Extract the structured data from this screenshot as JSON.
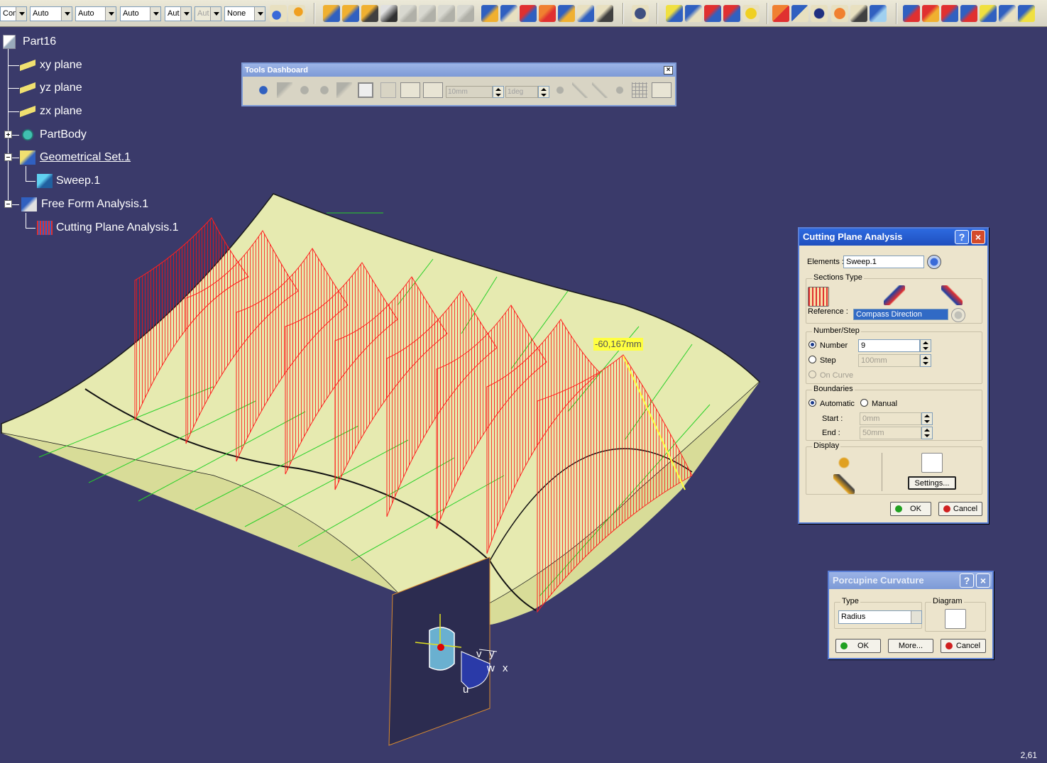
{
  "toolbar": {
    "combos": [
      {
        "value": "Come",
        "disabled": false
      },
      {
        "value": "Auto",
        "disabled": false
      },
      {
        "value": "Auto",
        "disabled": false
      },
      {
        "value": "Auto",
        "disabled": false
      },
      {
        "value": "Aut",
        "disabled": false
      },
      {
        "value": "Aut",
        "disabled": true
      },
      {
        "value": "None",
        "disabled": false
      }
    ]
  },
  "tree": {
    "root": "Part16",
    "nodes": [
      {
        "label": "xy plane",
        "icon": "plane-icon"
      },
      {
        "label": "yz plane",
        "icon": "plane-icon"
      },
      {
        "label": "zx plane",
        "icon": "plane-icon"
      },
      {
        "label": "PartBody",
        "icon": "gear-body-icon"
      },
      {
        "label": "Geometrical Set.1",
        "icon": "geometrical-set-icon"
      },
      {
        "label": "Sweep.1",
        "icon": "sweep-icon"
      },
      {
        "label": "Free Form Analysis.1",
        "icon": "analysis-icon"
      },
      {
        "label": "Cutting Plane Analysis.1",
        "icon": "cutting-plane-icon"
      }
    ]
  },
  "dashboard": {
    "title": "Tools Dashboard",
    "close": "×",
    "length_field": "10mm",
    "angle_field": "1deg"
  },
  "measure": {
    "value": "-60,167mm"
  },
  "cutting_plane": {
    "title": "Cutting Plane Analysis",
    "help": "?",
    "close": "×",
    "elements_label": "Elements :",
    "elements_value": "Sweep.1",
    "sections_type_label": "Sections Type",
    "reference_label": "Reference :",
    "reference_value": "Compass Direction",
    "number_step_label": "Number/Step",
    "number_label": "Number",
    "number_value": "9",
    "step_label": "Step",
    "step_value": "100mm",
    "on_curve_label": "On Curve",
    "boundaries_label": "Boundaries",
    "automatic_label": "Automatic",
    "manual_label": "Manual",
    "start_label": "Start :",
    "start_value": "0mm",
    "end_label": "End   :",
    "end_value": "50mm",
    "display_label": "Display",
    "settings_label": "Settings...",
    "ok_label": "OK",
    "cancel_label": "Cancel"
  },
  "porcupine": {
    "title": "Porcupine Curvature",
    "help": "?",
    "close": "×",
    "type_label": "Type",
    "type_value": "Radius",
    "diagram_label": "Diagram",
    "ok_label": "OK",
    "more_label": "More...",
    "cancel_label": "Cancel"
  },
  "compass": {
    "v": "v",
    "y": "y",
    "w": "w",
    "x": "x",
    "u": "u"
  },
  "status": {
    "zoom": "2,61"
  },
  "colors": {
    "background": "#3a3a6a",
    "surface": "#e6eab0",
    "section": "#ff1a1a",
    "title_active": "#1f4fbe"
  }
}
